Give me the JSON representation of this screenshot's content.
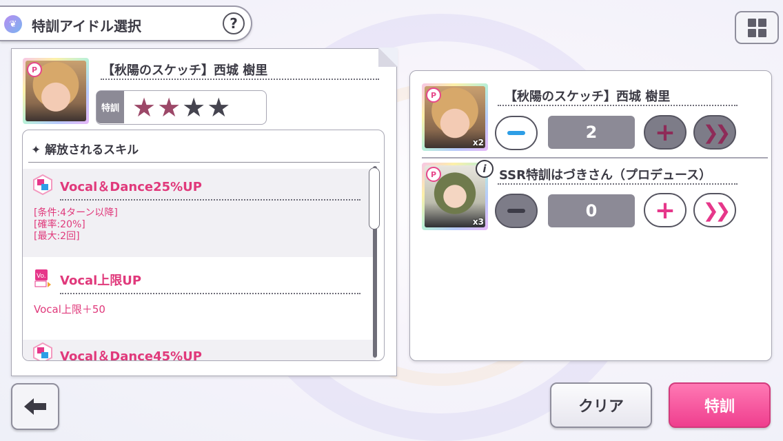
{
  "header": {
    "title": "特訓アイドル選択",
    "help_label": "?"
  },
  "selected_idol": {
    "name": "【秋陽のスケッチ】西城 樹里",
    "badge": "P",
    "training_label": "特訓",
    "training_stars_filled": 2,
    "training_stars_total": 4
  },
  "skills": {
    "heading": "✦ 解放されるスキル",
    "items": [
      {
        "name": "Vocal＆Dance25%UP",
        "icon": "vocal-dance-skill-icon",
        "desc": "[条件:4ターン以降]\n[確率:20%]\n[最大:2回]"
      },
      {
        "name": "Vocal上限UP",
        "icon": "vocal-cap-skill-icon",
        "desc": "Vocal上限＋50"
      },
      {
        "name": "Vocal＆Dance45%UP",
        "icon": "vocal-dance-skill-icon",
        "desc": ""
      }
    ]
  },
  "materials": [
    {
      "name": "【秋陽のスケッチ】西城 樹里",
      "owned": "x2",
      "quantity": "2",
      "badge": "P"
    },
    {
      "name": "SSR特訓はづきさん（プロデュース）",
      "owned": "x3",
      "quantity": "0",
      "badge": "P"
    }
  ],
  "controls": {
    "minus": "−",
    "plus": "+",
    "max": "»"
  },
  "footer": {
    "back_icon": "back-arrow-icon",
    "clear_label": "クリア",
    "train_label": "特訓"
  },
  "colors": {
    "accent_pink": "#e0397b",
    "minus_blue": "#2d9ee6",
    "train_button": "#ef3e8e"
  }
}
